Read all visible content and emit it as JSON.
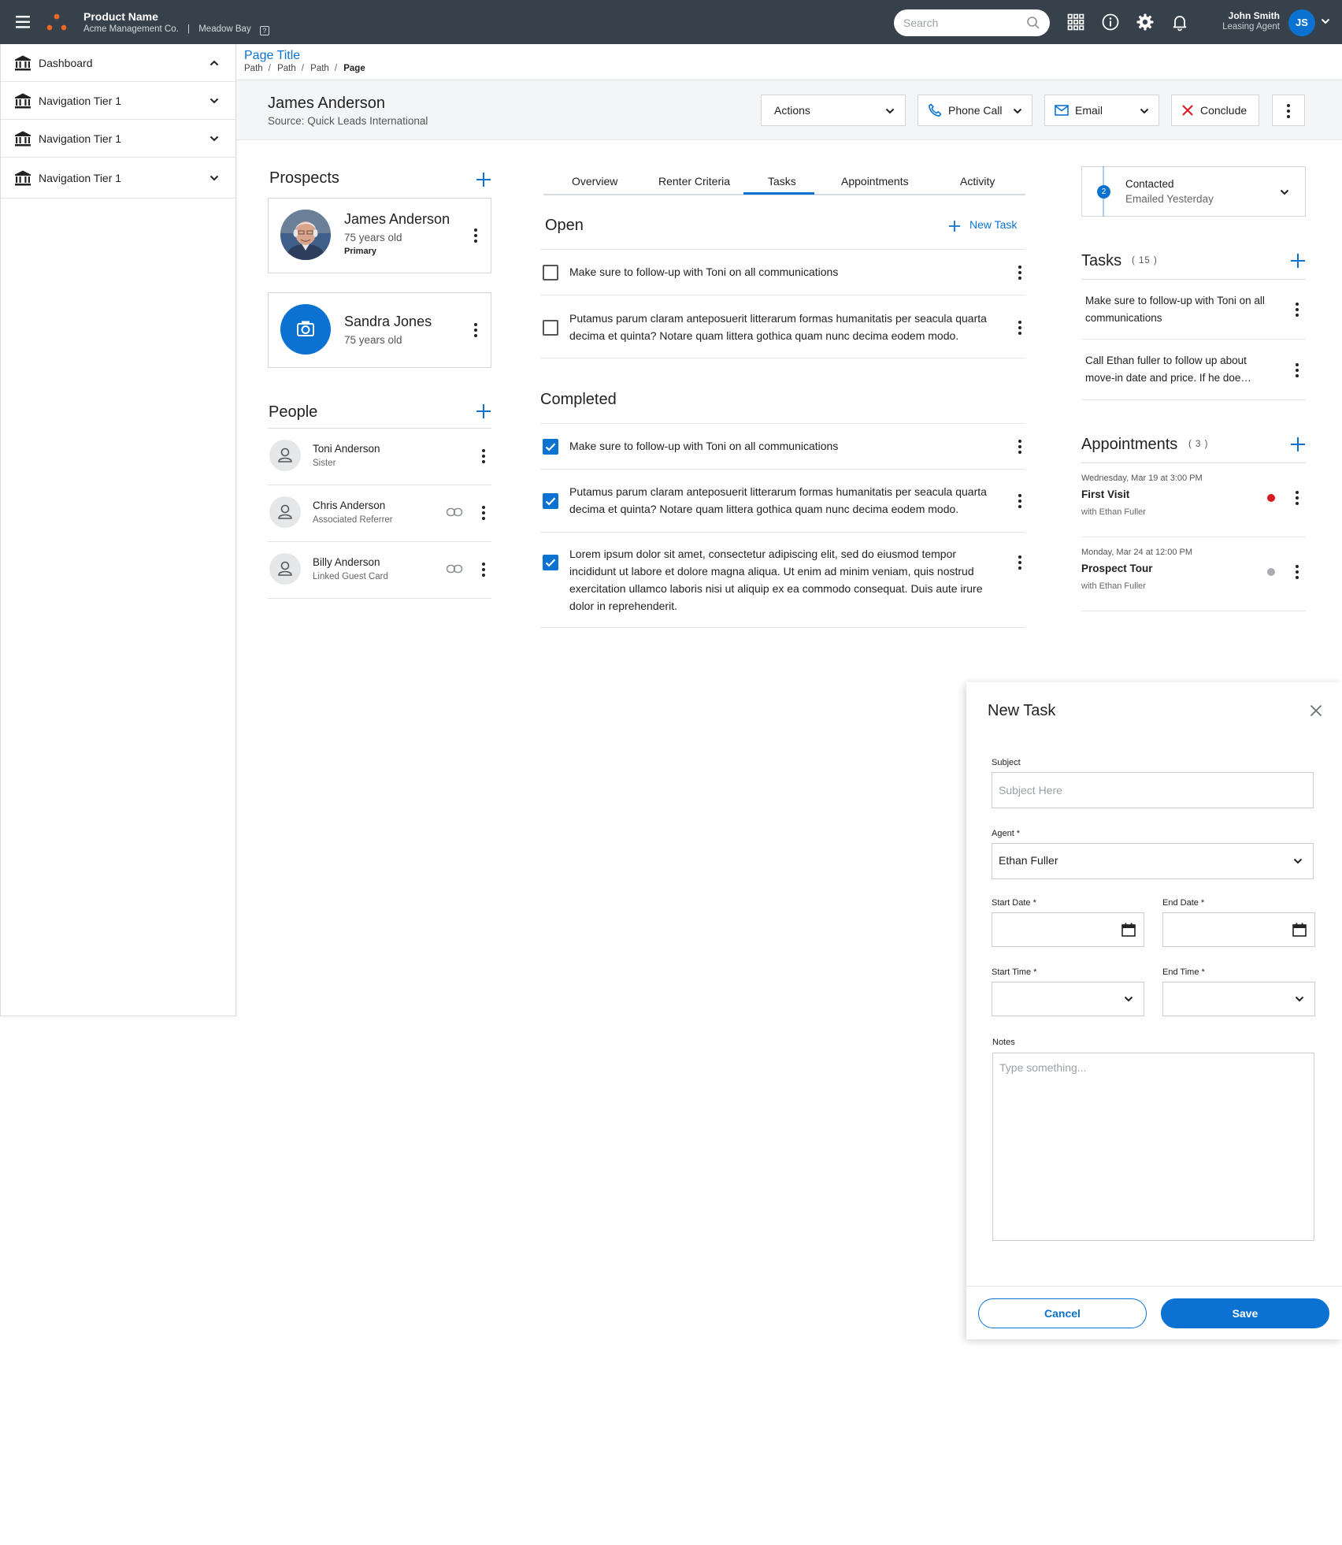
{
  "topbar": {
    "product_name": "Product Name",
    "company": "Acme Management Co.",
    "separator": "|",
    "property": "Meadow Bay",
    "search_placeholder": "Search",
    "user_name": "John Smith",
    "user_role": "Leasing Agent",
    "user_initials": "JS",
    "icons": [
      "menu-icon",
      "logo-icon",
      "search-icon",
      "apps-grid-icon",
      "info-icon",
      "gear-icon",
      "bell-icon",
      "chevron-down-icon"
    ]
  },
  "sidebar": {
    "items": [
      {
        "label": "Dashboard",
        "icon": "bank-icon",
        "expanded": true
      },
      {
        "label": "Navigation Tier 1",
        "icon": "bank-icon",
        "expanded": false
      },
      {
        "label": "Navigation Tier 1",
        "icon": "bank-icon",
        "expanded": false
      },
      {
        "label": "Navigation Tier 1",
        "icon": "bank-icon",
        "expanded": false
      }
    ]
  },
  "page": {
    "title": "Page Title",
    "breadcrumb": [
      "Path",
      "Path",
      "Path",
      "Page"
    ],
    "breadcrumb_separator": "/"
  },
  "lead": {
    "name": "James Anderson",
    "source": "Source: Quick Leads International",
    "buttons": {
      "actions": "Actions",
      "phone_call": "Phone Call",
      "email": "Email",
      "conclude": "Conclude"
    }
  },
  "prospects": {
    "title": "Prospects",
    "items": [
      {
        "name": "James Anderson",
        "age": "75 years old",
        "tag": "Primary"
      },
      {
        "name": "Sandra Jones",
        "age": "75 years old"
      }
    ]
  },
  "people": {
    "title": "People",
    "items": [
      {
        "name": "Toni Anderson",
        "relation": "Sister",
        "linked": false
      },
      {
        "name": "Chris Anderson",
        "relation": "Associated Referrer",
        "linked": true
      },
      {
        "name": "Billy Anderson",
        "relation": "Linked Guest Card",
        "linked": true
      }
    ]
  },
  "tabs": {
    "items": [
      "Overview",
      "Renter Criteria",
      "Tasks",
      "Appointments",
      "Activity"
    ],
    "active": "Tasks"
  },
  "tasks": {
    "open_title": "Open",
    "new_task_label": "New Task",
    "open": [
      {
        "text": "Make sure to follow-up with Toni on all communications",
        "checked": false
      },
      {
        "text": "Putamus parum claram anteposuerit litterarum formas humanitatis per seacula quarta decima et quinta? Notare quam littera gothica quam nunc decima eodem modo.",
        "checked": false
      }
    ],
    "completed_title": "Completed",
    "completed": [
      {
        "text": "Make sure to follow-up with Toni on all communications",
        "checked": true
      },
      {
        "text": "Putamus parum claram anteposuerit litterarum formas humanitatis per seacula quarta decima et quinta? Notare quam littera gothica quam nunc decima eodem modo.",
        "checked": true
      },
      {
        "text": "Lorem ipsum dolor sit amet, consectetur adipiscing elit, sed do eiusmod tempor incididunt ut labore et dolore magna aliqua. Ut enim ad minim veniam, quis nostrud exercitation ullamco laboris nisi ut aliquip ex ea commodo consequat. Duis aute irure dolor in reprehenderit.",
        "checked": true
      }
    ]
  },
  "status": {
    "step": "2",
    "title": "Contacted",
    "subtitle": "Emailed Yesterday"
  },
  "side_tasks": {
    "title": "Tasks",
    "count": "( 15 )",
    "items": [
      {
        "text": "Make sure to follow-up with Toni on all communications"
      },
      {
        "text": "Call Ethan fuller to follow up about move-in date and price. If he doe…"
      }
    ]
  },
  "appointments": {
    "title": "Appointments",
    "count": "( 3 )",
    "items": [
      {
        "datetime": "Wednesday, Mar 19 at 3:00 PM",
        "name": "First Visit",
        "with": "with Ethan Fuller",
        "status_color": "#d71920"
      },
      {
        "datetime": "Monday, Mar 24 at 12:00 PM",
        "name": "Prospect Tour",
        "with": "with Ethan Fuller",
        "status_color": "#a9adb1"
      }
    ]
  },
  "new_task_form": {
    "title": "New Task",
    "subject_label": "Subject",
    "subject_placeholder": "Subject Here",
    "agent_label": "Agent *",
    "agent_value": "Ethan Fuller",
    "start_date_label": "Start Date *",
    "end_date_label": "End Date *",
    "start_time_label": "Start Time *",
    "end_time_label": "End Time *",
    "notes_label": "Notes",
    "notes_placeholder": "Type something...",
    "cancel_label": "Cancel",
    "save_label": "Save"
  },
  "colors": {
    "topbar": "#37414b",
    "accent": "#0b72d2",
    "logo_orange": "#f26522",
    "danger": "#d71920"
  }
}
